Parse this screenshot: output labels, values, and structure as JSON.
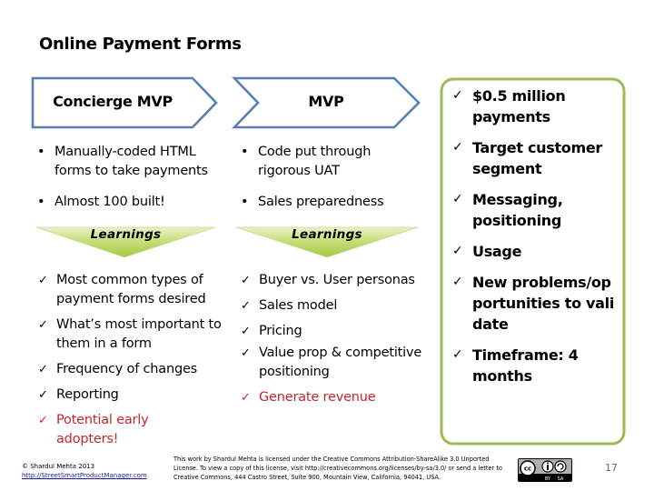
{
  "slide": {
    "title": "Online Payment Forms",
    "page_number": "17"
  },
  "stages": [
    {
      "label": "Concierge MVP",
      "activities": [
        "Manually-coded HTML forms to take payments",
        "Almost 100 built!"
      ],
      "learnings_label": "Learnings",
      "learnings": [
        {
          "text": "Most common types of payment forms desired",
          "highlight": false
        },
        {
          "text": "What’s most important to them in a form",
          "highlight": false
        },
        {
          "text": "Frequency of changes",
          "highlight": false
        },
        {
          "text": "Reporting",
          "highlight": false
        },
        {
          "text": "Potential early adopters!",
          "highlight": true
        }
      ]
    },
    {
      "label": "MVP",
      "activities": [
        "Code put through rigorous UAT",
        "Sales preparedness"
      ],
      "learnings_label": "Learnings",
      "learnings": [
        {
          "text": "Buyer vs. User personas",
          "highlight": false
        },
        {
          "text": "Sales model",
          "highlight": false
        },
        {
          "text": "Pricing",
          "highlight": false
        },
        {
          "text": "Value prop & competitive positioning",
          "highlight": false
        },
        {
          "text": "Generate revenue",
          "highlight": true
        }
      ]
    }
  ],
  "goals": [
    "$0.5 million payments",
    "Target customer segment",
    "Messaging, positioning",
    "Usage",
    "New problems/opportunities to validate",
    "Timeframe: 4 months"
  ],
  "marks": {
    "bullet": "•",
    "check": "✓"
  },
  "footer": {
    "copyright": "© Shardul Mehta 2013",
    "link": "http://StreetSmartProductManager.com",
    "license": "This work by Shardul Mehta is licensed under the Creative Commons Attribution-ShareAlike 3.0 Unported License. To view a copy of this license, visit http://creativecommons.org/licenses/by-sa/3.0/ or send a letter to Creative Commons, 444 Castro Street, Suite 900, Mountain View, California, 94041, USA.",
    "cc_badge": {
      "cc": "cc",
      "by": "BY",
      "sa": "SA"
    }
  },
  "colors": {
    "chevron_stroke": "#5b7fad",
    "goal_box_stroke": "#9bbb59",
    "highlight_red": "#c0272d",
    "learn_top": "#e7f1c4",
    "learn_bottom": "#a9c94a"
  }
}
